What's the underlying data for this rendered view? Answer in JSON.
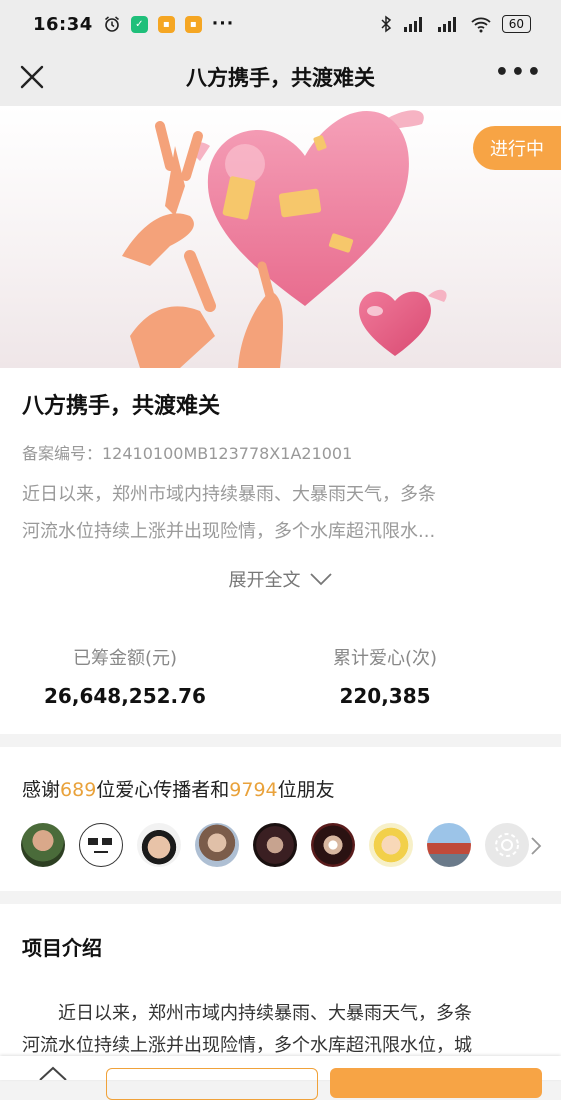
{
  "status_bar": {
    "time": "16:34",
    "battery": "60",
    "dots": "···"
  },
  "nav": {
    "title": "八方携手，共渡难关",
    "more": "•••"
  },
  "hero": {
    "status_badge": "进行中"
  },
  "project": {
    "title": "八方携手，共渡难关",
    "registration": "备案编号：12410100MB123778X1A21001",
    "summary_lines": [
      "近日以来，郑州市域内持续暴雨、大暴雨天气，多条",
      "河流水位持续上涨并出现险情，多个水库超汛限水..."
    ],
    "expand_label": "展开全文"
  },
  "stats": {
    "raised_label": "已筹金额(元)",
    "raised_value": "26,648,252.76",
    "donations_label": "累计爱心(次)",
    "donations_value": "220,385"
  },
  "supporters": {
    "prefix": "感谢",
    "spreaders_count": "689",
    "middle": "位爱心传播者和",
    "friends_count": "9794",
    "suffix": "位朋友"
  },
  "intro": {
    "title": "项目介绍",
    "lines": [
      "　　近日以来，郑州市域内持续暴雨、大暴雨天气，多条",
      "河流水位持续上涨并出现险情，多个水库超汛限水位，城"
    ]
  },
  "colors": {
    "accent": "#f7a445",
    "highlight": "#e9a23b"
  }
}
